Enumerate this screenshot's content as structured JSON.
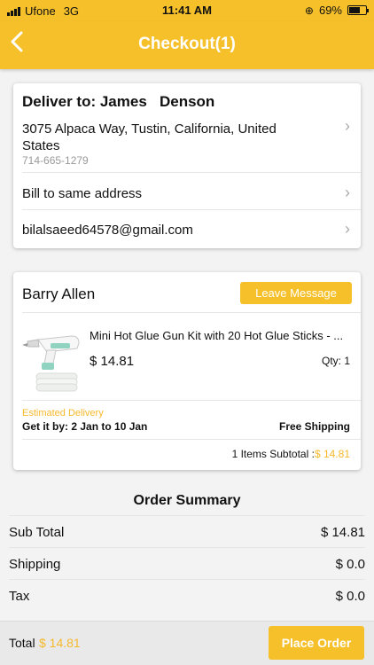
{
  "status_bar": {
    "carrier": "Ufone",
    "network": "3G",
    "time": "11:41 AM",
    "battery": "69%",
    "battery_level": 0.69
  },
  "header": {
    "title": "Checkout(1)",
    "back_icon": "chevron-left-icon"
  },
  "address": {
    "deliver_to": "Deliver to: James   Denson",
    "address_line": "3075 Alpaca Way, Tustin, California, United States",
    "phone": "714-665-1279",
    "bill_to": "Bill to same address",
    "email": "bilalsaeed64578@gmail.com"
  },
  "seller": {
    "name": "Barry Allen",
    "leave_message": "Leave Message",
    "product": {
      "name": "Mini Hot Glue Gun Kit with 20 Hot Glue Sticks - ...",
      "price": "$ 14.81",
      "qty": "Qty: 1"
    },
    "estimated_delivery_label": "Estimated Delivery",
    "get_it_by": "Get it by: 2 Jan to 10 Jan",
    "shipping": "Free Shipping",
    "subtotal_label": "1 Items Subtotal :",
    "subtotal_value": "$ 14.81"
  },
  "order_summary": {
    "title": "Order Summary",
    "rows": [
      {
        "label": "Sub Total",
        "value": "$ 14.81"
      },
      {
        "label": "Shipping",
        "value": "$ 0.0"
      },
      {
        "label": "Tax",
        "value": "$ 0.0"
      }
    ]
  },
  "footer": {
    "total_label": "Total",
    "total_value": "$ 14.81",
    "place_order": "Place Order"
  },
  "colors": {
    "accent": "#f6c02b",
    "accent_text": "#f6b82b"
  }
}
